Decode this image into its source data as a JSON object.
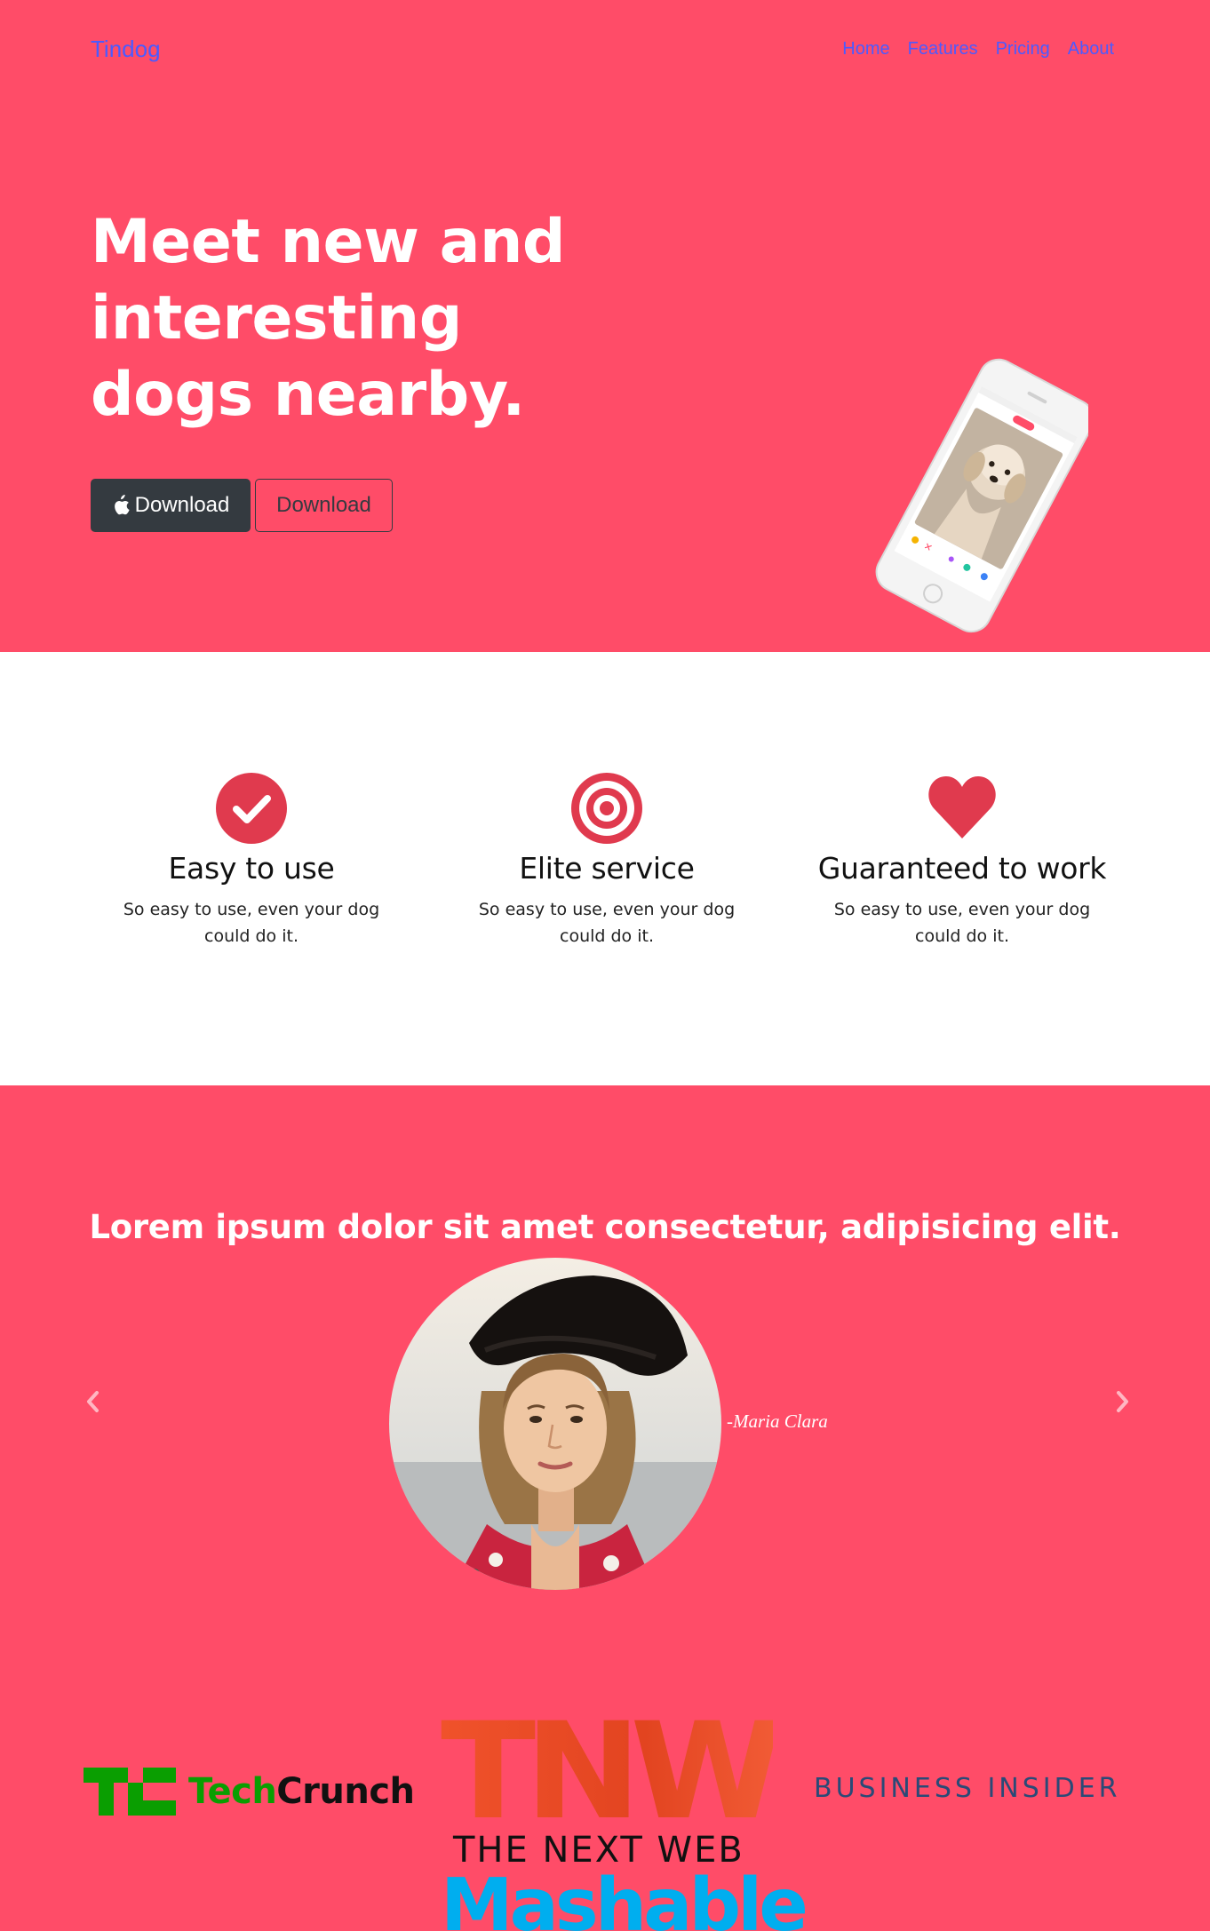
{
  "nav": {
    "brand": "Tindog",
    "links": [
      "Home",
      "Features",
      "Pricing",
      "About"
    ]
  },
  "hero": {
    "headline": "Meet new and interesting dogs nearby.",
    "download_primary": "Download",
    "download_secondary": "Download"
  },
  "features": [
    {
      "icon": "check-circle-icon",
      "title": "Easy to use",
      "text": "So easy to use, even your dog could do it."
    },
    {
      "icon": "bullseye-icon",
      "title": "Elite service",
      "text": "So easy to use, even your dog could do it."
    },
    {
      "icon": "heart-icon",
      "title": "Guaranteed to work",
      "text": "So easy to use, even your dog could do it."
    }
  ],
  "testimonial": {
    "quote": "Lorem ipsum dolor sit amet consectetur, adipisicing elit.",
    "author": "-Maria Clara"
  },
  "press": {
    "techcrunch": {
      "part1": "Tech",
      "part2": "Crunch"
    },
    "tnw": {
      "mark": "TNW",
      "subtitle": "THE NEXT WEB"
    },
    "business_insider": "BUSINESS INSIDER",
    "mashable": "Mashable"
  },
  "colors": {
    "brand": "#ff4c68",
    "accent": "#e03a4e",
    "link": "#4b5bff",
    "dark_button": "#343a40"
  }
}
